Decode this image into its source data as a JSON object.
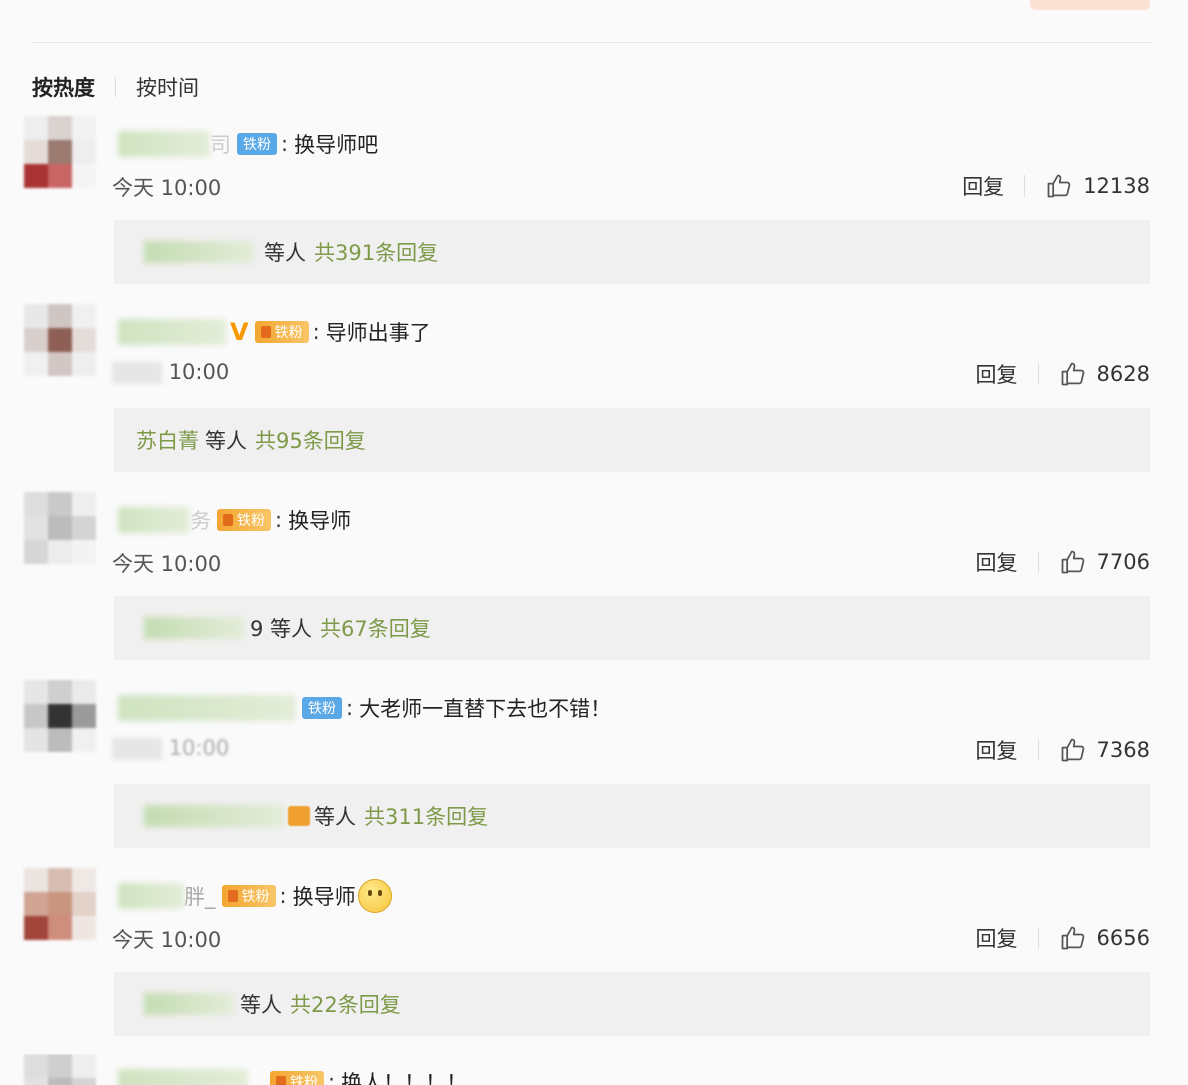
{
  "sort_tabs": {
    "hot": "按热度",
    "time": "按时间"
  },
  "badge_label": "铁粉",
  "reply_label": "回复",
  "colors": {
    "accent_green": "#7e9a48",
    "badge_blue": "#5aa9e6",
    "badge_gold": "#f3a530",
    "vip_orange": "#f59b00"
  },
  "comments": [
    {
      "name_suffix": "司",
      "text": "换导师吧",
      "time": "今天 10:00",
      "likes": "12138",
      "thread_who": "等人",
      "thread_count": "共391条回复"
    },
    {
      "name_suffix": "V",
      "text": "导师出事了",
      "time": "10:00",
      "likes": "8628",
      "thread_users": "苏白菁",
      "thread_who": "等人",
      "thread_count": "共95条回复"
    },
    {
      "name_suffix": "务",
      "text": "换导师",
      "time": "今天 10:00",
      "likes": "7706",
      "thread_who": "9 等人",
      "thread_count": "共67条回复"
    },
    {
      "text": "大老师一直替下去也不错！",
      "time": "10:00",
      "likes": "7368",
      "thread_who": "等人",
      "thread_count": "共311条回复"
    },
    {
      "name_suffix": "胖_",
      "text": "换导师",
      "time": "今天 10:00",
      "likes": "6656",
      "thread_who": "等人",
      "thread_count": "共22条回复"
    },
    {
      "text": "换人！！！！"
    }
  ]
}
